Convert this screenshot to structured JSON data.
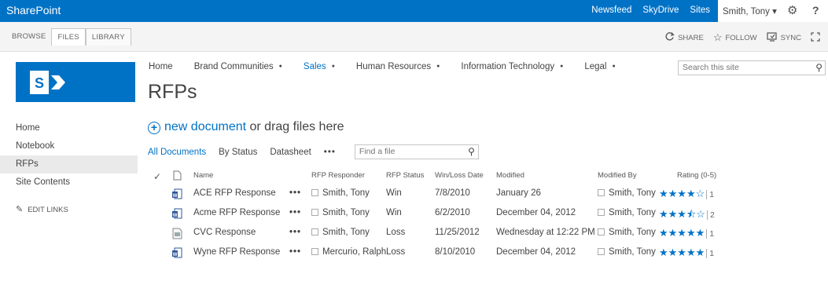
{
  "suite": {
    "brand": "SharePoint",
    "links": [
      "Newsfeed",
      "SkyDrive",
      "Sites"
    ],
    "user": "Smith, Tony ▾",
    "gear": "⚙",
    "help": "?"
  },
  "ribbon": {
    "tabs": [
      "BROWSE",
      "FILES",
      "LIBRARY"
    ],
    "actions": [
      {
        "icon": "share-icon",
        "label": "SHARE"
      },
      {
        "icon": "follow-icon",
        "label": "FOLLOW"
      },
      {
        "icon": "sync-icon",
        "label": "SYNC"
      }
    ]
  },
  "topnav": [
    {
      "label": "Home",
      "caret": false,
      "current": false
    },
    {
      "label": "Brand Communities",
      "caret": true,
      "current": false
    },
    {
      "label": "Sales",
      "caret": true,
      "current": true
    },
    {
      "label": "Human Resources",
      "caret": true,
      "current": false
    },
    {
      "label": "Information Technology",
      "caret": true,
      "current": false
    },
    {
      "label": "Legal",
      "caret": true,
      "current": false
    }
  ],
  "search": {
    "placeholder": "Search this site"
  },
  "page": {
    "title": "RFPs"
  },
  "leftnav": {
    "items": [
      "Home",
      "Notebook",
      "RFPs",
      "Site Contents"
    ],
    "selected": "RFPs",
    "edit_links": "EDIT LINKS"
  },
  "newdoc": {
    "link": "new document",
    "rest": " or drag files here"
  },
  "views": {
    "items": [
      "All Documents",
      "By Status",
      "Datasheet"
    ],
    "more": "•••",
    "find_placeholder": "Find a file"
  },
  "table": {
    "headers": {
      "name": "Name",
      "responder": "RFP Responder",
      "status": "RFP Status",
      "winloss": "Win/Loss Date",
      "modified": "Modified",
      "modified_by": "Modified By",
      "rating": "Rating (0-5)"
    },
    "rows": [
      {
        "name": "ACE RFP Response",
        "type": "word",
        "responder": "Smith, Tony",
        "status": "Win",
        "date": "7/8/2010",
        "modified": "January 26",
        "modified_by": "Smith, Tony",
        "stars": "★★★★☆",
        "rating": 4,
        "count": "1"
      },
      {
        "name": "Acme RFP Response",
        "type": "word",
        "responder": "Smith, Tony",
        "status": "Win",
        "date": "6/2/2010",
        "modified": "December 04, 2012",
        "modified_by": "Smith, Tony",
        "stars": "★★★⯪☆",
        "rating": 3.5,
        "count": "2"
      },
      {
        "name": "CVC Response",
        "type": "generic",
        "responder": "Smith, Tony",
        "status": "Loss",
        "date": "11/25/2012",
        "modified": "Wednesday at 12:22 PM",
        "modified_by": "Smith, Tony",
        "stars": "★★★★★",
        "rating": 5,
        "count": "1"
      },
      {
        "name": "Wyne RFP Response",
        "type": "word",
        "responder": "Mercurio, Ralph",
        "status": "Loss",
        "date": "8/10/2010",
        "modified": "December 04, 2012",
        "modified_by": "Smith, Tony",
        "stars": "★★★★★",
        "rating": 5,
        "count": "1"
      }
    ],
    "ellipsis": "•••"
  },
  "colors": {
    "brand": "#0072c6",
    "text": "#444444"
  }
}
